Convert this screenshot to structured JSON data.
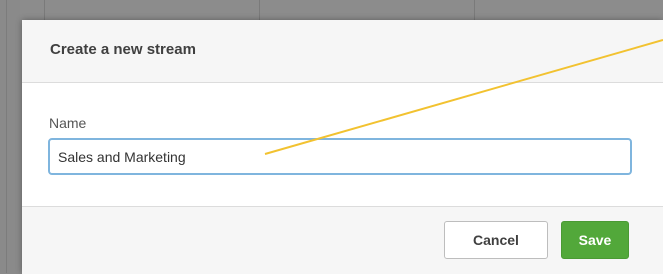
{
  "dialog": {
    "title": "Create a new stream",
    "name_label": "Name",
    "name_value": "Sales and Marketing",
    "cancel_label": "Cancel",
    "save_label": "Save"
  },
  "colors": {
    "save_button": "#52a83a",
    "input_focus_border": "#7fb5de",
    "annotation_line": "#f2c230",
    "backdrop": "#8a8a8a"
  }
}
